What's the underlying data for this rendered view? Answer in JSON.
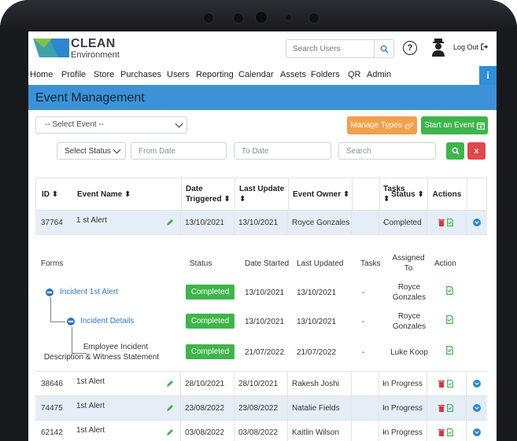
{
  "brand": {
    "name_line1": "CLEAN",
    "name_line2": "Environment",
    "colors": {
      "teal": "#3ea3a8",
      "green": "#7fc24a",
      "blue": "#2f86d0"
    }
  },
  "header": {
    "search_placeholder": "Search Users",
    "help_glyph": "?",
    "logout_label": "Log Out"
  },
  "nav": {
    "items": [
      "Home",
      "Profile",
      "Store",
      "Purchases",
      "Users",
      "Reporting",
      "Calendar",
      "Assets",
      "Folders",
      "QR",
      "Admin"
    ],
    "info_glyph": "i"
  },
  "page": {
    "title": "Event Management"
  },
  "filters": {
    "select_event": "-- Select Event --",
    "select_status": "Select Status",
    "from_date_placeholder": "From Date",
    "to_date_placeholder": "To Date",
    "search_placeholder": "Search",
    "manage_types_label": "Manage Types",
    "start_event_label": "Start an Event",
    "clear_glyph": "x"
  },
  "table": {
    "headers": {
      "id": "ID ⬍",
      "name": "Event Name ⬍",
      "triggered_l1": "Date",
      "triggered_l2": "Triggered ⬍",
      "update_l1": "Last Update",
      "update_l2": "⬍",
      "owner": "Event Owner ⬍",
      "tasks_l1": "Tasks",
      "tasks_l2": "⬍",
      "status": "Status ⬍",
      "actions": "Actions"
    },
    "rows": [
      {
        "id": "37764",
        "name": "1 st Alert",
        "triggered": "13/10/2021",
        "updated": "13/10/2021",
        "owner": "Royce Gonzales",
        "tasks": "-",
        "status": "Completed"
      },
      {
        "id": "38646",
        "name": "1st Alert",
        "triggered": "28/10/2021",
        "updated": "28/10/2021",
        "owner": "Rakesh Joshi",
        "tasks": "-",
        "status": "In Progress"
      },
      {
        "id": "74475",
        "name": "1st Alert",
        "triggered": "23/08/2022",
        "updated": "23/08/2022",
        "owner": "Natalie Fields",
        "tasks": "-",
        "status": "In Progress"
      },
      {
        "id": "62142",
        "name": "1st Alert",
        "triggered": "03/08/2022",
        "updated": "03/08/2022",
        "owner": "Kaitlin Wilson",
        "tasks": "-",
        "status": "In Progress"
      }
    ]
  },
  "detail": {
    "headers": {
      "forms": "Forms",
      "status": "Status",
      "started": "Date Started",
      "updated": "Last Updated",
      "tasks": "Tasks",
      "assigned_l1": "Assigned",
      "assigned_l2": "To",
      "action": "Action"
    },
    "forms": [
      {
        "name": "Incident 1st Alert",
        "status": "Completed",
        "started": "13/10/2021",
        "updated": "13/10/2021",
        "tasks": "-",
        "assigned_l1": "Royce",
        "assigned_l2": "Gonzales"
      },
      {
        "name": "Incident Details",
        "status": "Completed",
        "started": "13/10/2021",
        "updated": "13/10/2021",
        "tasks": "-",
        "assigned_l1": "Royce",
        "assigned_l2": "Gonzales"
      },
      {
        "name_l1": "Employee Incident",
        "name_l2": "Description & Witness Statement",
        "status": "Completed",
        "started": "21/07/2022",
        "updated": "21/07/2022",
        "tasks": "-",
        "assigned_l1": "Luke Koop",
        "assigned_l2": ""
      }
    ]
  },
  "icons": [
    "search-icon",
    "help-icon",
    "user-icon",
    "logout-icon",
    "info-icon",
    "cogs-icon",
    "calendar-plus-icon",
    "pencil-icon",
    "trash-icon",
    "document-icon",
    "expand-icon",
    "collapse-icon"
  ]
}
